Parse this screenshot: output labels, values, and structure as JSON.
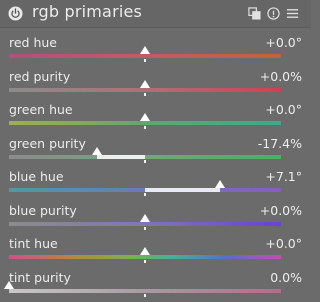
{
  "header": {
    "title": "rgb primaries",
    "icons": [
      "power-icon",
      "instances-icon",
      "reset-icon",
      "presets-icon"
    ]
  },
  "sliders": [
    {
      "label": "red hue",
      "value": "+0.0°",
      "position": 0.5,
      "fill": false,
      "gradient": "linear-gradient(90deg,#b2507e 0%,#c25a66 50%,#c0623f 100%)"
    },
    {
      "label": "red purity",
      "value": "+0.0%",
      "position": 0.5,
      "fill": false,
      "gradient": "linear-gradient(90deg,#8c8c8c 0%,#b26e78 50%,#d23f55 100%)"
    },
    {
      "label": "green hue",
      "value": "+0.0°",
      "position": 0.5,
      "fill": false,
      "gradient": "linear-gradient(90deg,#9fae55 0%,#62a868 50%,#3fa88c 100%)"
    },
    {
      "label": "green purity",
      "value": "-17.4%",
      "position": 0.325,
      "fill": true,
      "gradient": "linear-gradient(90deg,#8c8c8c 0%,#74a57c 50%,#3fb46a 100%)"
    },
    {
      "label": "blue hue",
      "value": "+7.1°",
      "position": 0.775,
      "fill": true,
      "gradient": "linear-gradient(90deg,#4f9aa6 0%,#6a7bb5 50%,#8a5cc0 100%)"
    },
    {
      "label": "blue purity",
      "value": "+0.0%",
      "position": 0.5,
      "fill": false,
      "gradient": "linear-gradient(90deg,#8c8c8c 0%,#7f77b0 50%,#6a42d6 100%)"
    },
    {
      "label": "tint hue",
      "value": "+0.0°",
      "position": 0.5,
      "fill": false,
      "gradient": "linear-gradient(90deg,#d0508a 0%,#b08c3c 25%,#7cb04c 45%,#46b09a 60%,#5a6cc8 80%,#c050b0 100%)"
    },
    {
      "label": "tint purity",
      "value": "0.0%",
      "position": 0.0,
      "fill": false,
      "gradient": "linear-gradient(90deg,#c8c8c8 0%,#a89aa0 50%,#b86a8a 100%)"
    }
  ]
}
